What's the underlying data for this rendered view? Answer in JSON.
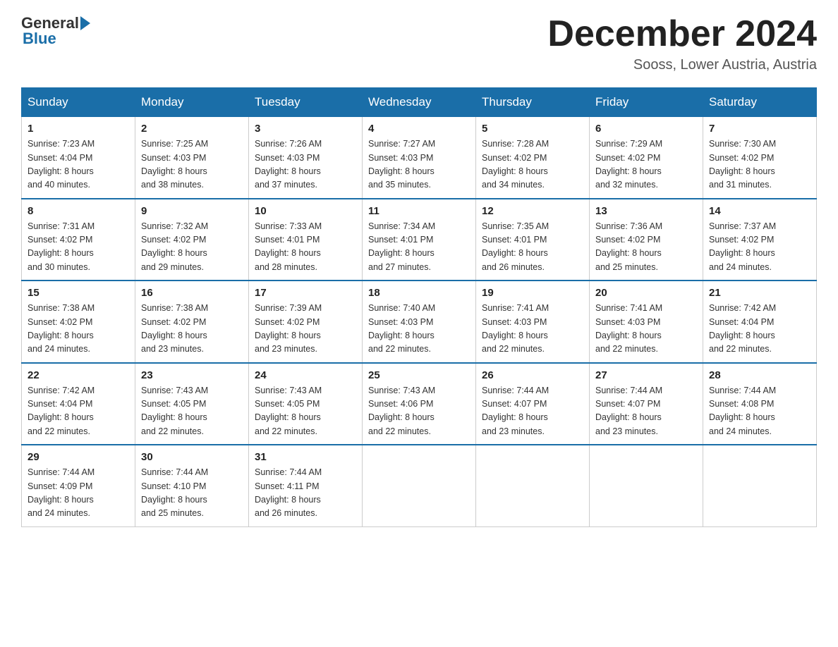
{
  "header": {
    "logo_general": "General",
    "logo_blue": "Blue",
    "month_title": "December 2024",
    "location": "Sooss, Lower Austria, Austria"
  },
  "days_of_week": [
    "Sunday",
    "Monday",
    "Tuesday",
    "Wednesday",
    "Thursday",
    "Friday",
    "Saturday"
  ],
  "weeks": [
    [
      {
        "num": "1",
        "sunrise": "7:23 AM",
        "sunset": "4:04 PM",
        "daylight": "8 hours and 40 minutes."
      },
      {
        "num": "2",
        "sunrise": "7:25 AM",
        "sunset": "4:03 PM",
        "daylight": "8 hours and 38 minutes."
      },
      {
        "num": "3",
        "sunrise": "7:26 AM",
        "sunset": "4:03 PM",
        "daylight": "8 hours and 37 minutes."
      },
      {
        "num": "4",
        "sunrise": "7:27 AM",
        "sunset": "4:03 PM",
        "daylight": "8 hours and 35 minutes."
      },
      {
        "num": "5",
        "sunrise": "7:28 AM",
        "sunset": "4:02 PM",
        "daylight": "8 hours and 34 minutes."
      },
      {
        "num": "6",
        "sunrise": "7:29 AM",
        "sunset": "4:02 PM",
        "daylight": "8 hours and 32 minutes."
      },
      {
        "num": "7",
        "sunrise": "7:30 AM",
        "sunset": "4:02 PM",
        "daylight": "8 hours and 31 minutes."
      }
    ],
    [
      {
        "num": "8",
        "sunrise": "7:31 AM",
        "sunset": "4:02 PM",
        "daylight": "8 hours and 30 minutes."
      },
      {
        "num": "9",
        "sunrise": "7:32 AM",
        "sunset": "4:02 PM",
        "daylight": "8 hours and 29 minutes."
      },
      {
        "num": "10",
        "sunrise": "7:33 AM",
        "sunset": "4:01 PM",
        "daylight": "8 hours and 28 minutes."
      },
      {
        "num": "11",
        "sunrise": "7:34 AM",
        "sunset": "4:01 PM",
        "daylight": "8 hours and 27 minutes."
      },
      {
        "num": "12",
        "sunrise": "7:35 AM",
        "sunset": "4:01 PM",
        "daylight": "8 hours and 26 minutes."
      },
      {
        "num": "13",
        "sunrise": "7:36 AM",
        "sunset": "4:02 PM",
        "daylight": "8 hours and 25 minutes."
      },
      {
        "num": "14",
        "sunrise": "7:37 AM",
        "sunset": "4:02 PM",
        "daylight": "8 hours and 24 minutes."
      }
    ],
    [
      {
        "num": "15",
        "sunrise": "7:38 AM",
        "sunset": "4:02 PM",
        "daylight": "8 hours and 24 minutes."
      },
      {
        "num": "16",
        "sunrise": "7:38 AM",
        "sunset": "4:02 PM",
        "daylight": "8 hours and 23 minutes."
      },
      {
        "num": "17",
        "sunrise": "7:39 AM",
        "sunset": "4:02 PM",
        "daylight": "8 hours and 23 minutes."
      },
      {
        "num": "18",
        "sunrise": "7:40 AM",
        "sunset": "4:03 PM",
        "daylight": "8 hours and 22 minutes."
      },
      {
        "num": "19",
        "sunrise": "7:41 AM",
        "sunset": "4:03 PM",
        "daylight": "8 hours and 22 minutes."
      },
      {
        "num": "20",
        "sunrise": "7:41 AM",
        "sunset": "4:03 PM",
        "daylight": "8 hours and 22 minutes."
      },
      {
        "num": "21",
        "sunrise": "7:42 AM",
        "sunset": "4:04 PM",
        "daylight": "8 hours and 22 minutes."
      }
    ],
    [
      {
        "num": "22",
        "sunrise": "7:42 AM",
        "sunset": "4:04 PM",
        "daylight": "8 hours and 22 minutes."
      },
      {
        "num": "23",
        "sunrise": "7:43 AM",
        "sunset": "4:05 PM",
        "daylight": "8 hours and 22 minutes."
      },
      {
        "num": "24",
        "sunrise": "7:43 AM",
        "sunset": "4:05 PM",
        "daylight": "8 hours and 22 minutes."
      },
      {
        "num": "25",
        "sunrise": "7:43 AM",
        "sunset": "4:06 PM",
        "daylight": "8 hours and 22 minutes."
      },
      {
        "num": "26",
        "sunrise": "7:44 AM",
        "sunset": "4:07 PM",
        "daylight": "8 hours and 23 minutes."
      },
      {
        "num": "27",
        "sunrise": "7:44 AM",
        "sunset": "4:07 PM",
        "daylight": "8 hours and 23 minutes."
      },
      {
        "num": "28",
        "sunrise": "7:44 AM",
        "sunset": "4:08 PM",
        "daylight": "8 hours and 24 minutes."
      }
    ],
    [
      {
        "num": "29",
        "sunrise": "7:44 AM",
        "sunset": "4:09 PM",
        "daylight": "8 hours and 24 minutes."
      },
      {
        "num": "30",
        "sunrise": "7:44 AM",
        "sunset": "4:10 PM",
        "daylight": "8 hours and 25 minutes."
      },
      {
        "num": "31",
        "sunrise": "7:44 AM",
        "sunset": "4:11 PM",
        "daylight": "8 hours and 26 minutes."
      },
      null,
      null,
      null,
      null
    ]
  ],
  "labels": {
    "sunrise": "Sunrise:",
    "sunset": "Sunset:",
    "daylight": "Daylight:"
  }
}
